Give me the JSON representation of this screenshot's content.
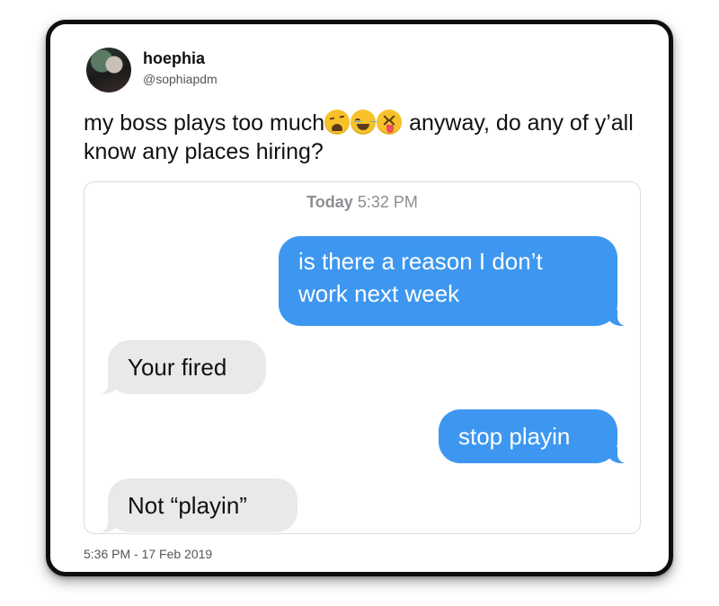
{
  "tweet": {
    "display_name": "hoephia",
    "handle": "@sophiapdm",
    "text_part1": "my boss plays too much",
    "emojis": [
      "weary-face-icon",
      "face-with-tears-of-joy-icon",
      "squinting-face-with-tongue-icon"
    ],
    "text_part2": " anyway, do any of y’all know any places hiring?",
    "timestamp": "5:36 PM - 17 Feb 2019"
  },
  "chat": {
    "header_day": "Today",
    "header_time": " 5:32 PM",
    "messages": [
      {
        "side": "sent",
        "text": "is there a reason I don’t work next week"
      },
      {
        "side": "received",
        "text": "Your fired"
      },
      {
        "side": "sent",
        "text": "stop playin"
      },
      {
        "side": "received",
        "text": "Not “playin”"
      }
    ]
  },
  "colors": {
    "sent_bubble": "#3d97f0",
    "received_bubble": "#e9e9eb",
    "frame_border": "#0d0d0d"
  }
}
